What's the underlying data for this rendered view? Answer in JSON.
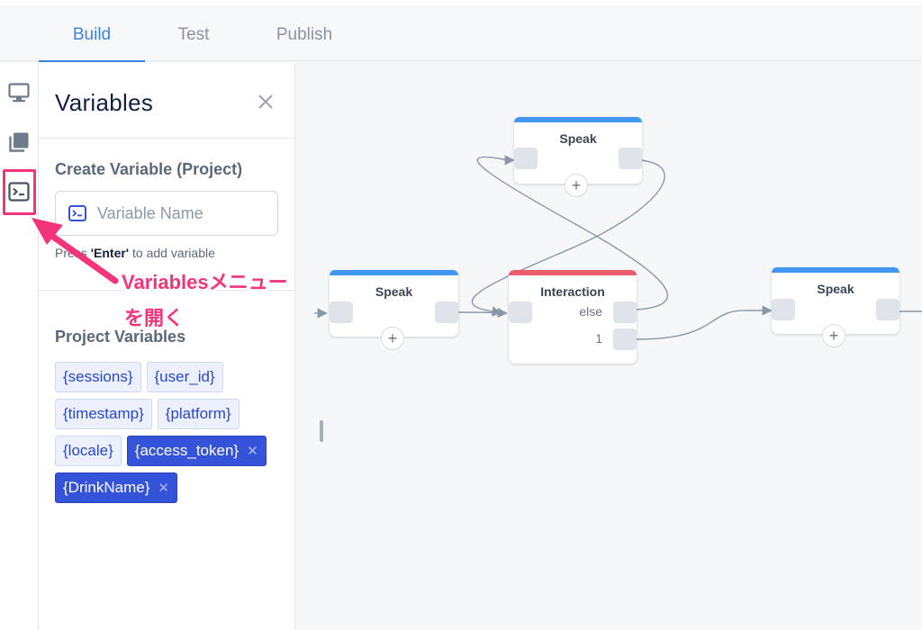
{
  "tabs": [
    {
      "label": "Build",
      "active": true
    },
    {
      "label": "Test",
      "active": false
    },
    {
      "label": "Publish",
      "active": false
    }
  ],
  "rail": {
    "icons": [
      "display-icon",
      "library-icon",
      "variables-terminal-icon"
    ],
    "active": "variables-terminal-icon"
  },
  "panel": {
    "title": "Variables",
    "create_label": "Create Variable (Project)",
    "input_placeholder": "Variable Name",
    "input_value": "",
    "hint_prefix": "Press ",
    "hint_key": "'Enter'",
    "hint_suffix": " to add variable",
    "project_label": "Project Variables",
    "variables": [
      {
        "name": "{sessions}",
        "removable": false
      },
      {
        "name": "{user_id}",
        "removable": false
      },
      {
        "name": "{timestamp}",
        "removable": false
      },
      {
        "name": "{platform}",
        "removable": false
      },
      {
        "name": "{locale}",
        "removable": false
      },
      {
        "name": "{access_token}",
        "removable": true
      },
      {
        "name": "{DrinkName}",
        "removable": true
      }
    ],
    "remove_glyph": "✕"
  },
  "canvas": {
    "blocks": [
      {
        "id": "speak-top",
        "title": "Speak",
        "type": "speak"
      },
      {
        "id": "speak-left",
        "title": "Speak",
        "type": "speak"
      },
      {
        "id": "interaction",
        "title": "Interaction",
        "type": "interaction",
        "ports": [
          "else",
          "1"
        ]
      },
      {
        "id": "speak-right",
        "title": "Speak",
        "type": "speak"
      }
    ],
    "add_glyph": "+"
  },
  "annotation": {
    "line1": "Variablesメニュー",
    "line2": "を開く"
  },
  "colors": {
    "accent": "#3d82e2",
    "speak_bar": "#4297f0",
    "interaction_bar": "#ea5d6f",
    "chip_selected": "#3553d9",
    "annotation": "#f3347b",
    "wire": "#8a97a8"
  }
}
